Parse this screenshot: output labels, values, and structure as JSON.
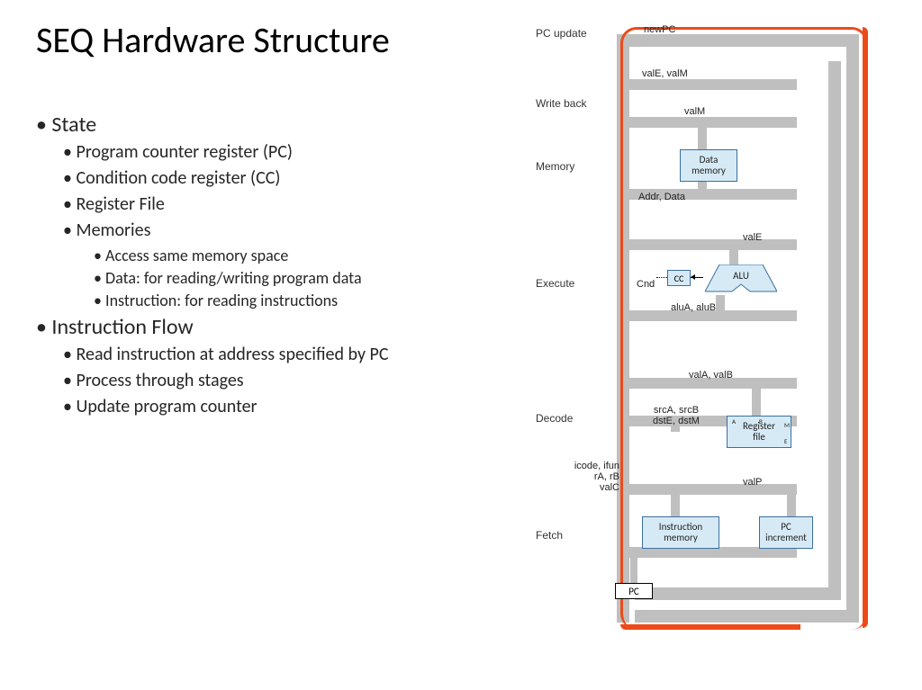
{
  "title": "SEQ Hardware Structure",
  "bullets": {
    "state": "State",
    "pc": "Program counter register (PC)",
    "cc": "Condition code register (CC)",
    "rf": "Register File",
    "mem": "Memories",
    "mem1": "Access same memory space",
    "mem2": "Data: for reading/writing program data",
    "mem3": "Instruction: for reading instructions",
    "iflow": "Instruction Flow",
    "if1": "Read instruction at address specified by PC",
    "if2": "Process through stages",
    "if3": "Update program counter"
  },
  "stages": {
    "pcupdate": "PC update",
    "writeback": "Write back",
    "memory": "Memory",
    "execute": "Execute",
    "decode": "Decode",
    "fetch": "Fetch"
  },
  "signals": {
    "newPC": "newPC",
    "valE_valM": "valE, valM",
    "valM": "valM",
    "addr_data": "Addr, Data",
    "valE": "valE",
    "cnd": "Cnd",
    "aluA_aluB": "aluA, aluB",
    "valA_valB": "valA, valB",
    "srcdst": "srcA, srcB\ndstE, dstM",
    "valP": "valP",
    "icode": "icode, ifun\nrA, rB\nvalC"
  },
  "blocks": {
    "data_mem": "Data\nmemory",
    "cc": "CC",
    "alu": "ALU",
    "reg_file": "Register\nfile",
    "instr_mem": "Instruction\nmemory",
    "pc_inc": "PC\nincrement",
    "pc": "PC"
  },
  "ports": {
    "a": "A",
    "b": "B",
    "m": "M",
    "e": "E"
  }
}
